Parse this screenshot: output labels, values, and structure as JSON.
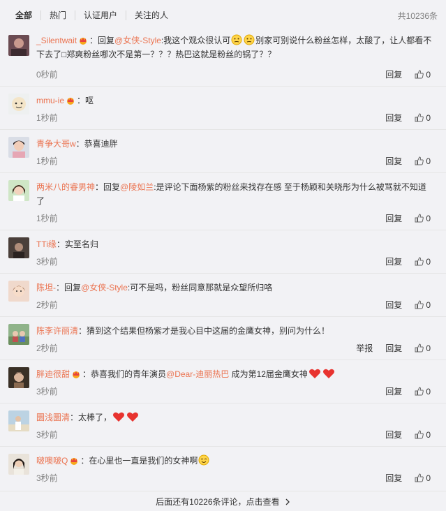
{
  "tabs": [
    {
      "label": "全部"
    },
    {
      "label": "热门"
    },
    {
      "label": "认证用户"
    },
    {
      "label": "关注的人"
    }
  ],
  "total_count": "共10236条",
  "reply_label": "回复",
  "report_label": "举报",
  "comments": [
    {
      "user": "_Silentwait",
      "time": "0秒前",
      "likes": "0",
      "pre": "：回复",
      "at": "@女侠-Style",
      "text1": ":我这个观众很认可",
      "text2": "别家可别说什么粉丝怎样，太酸了，让人都看不下去了□郑爽粉丝哪次不是第一？？？热巴这就是粉丝的锅了？？"
    },
    {
      "user": "mmu-ie",
      "time": "1秒前",
      "likes": "0",
      "text": "：呕"
    },
    {
      "user": "青争大哥w",
      "time": "1秒前",
      "likes": "0",
      "text": "：恭喜迪胖"
    },
    {
      "user": "两米八的睿男神",
      "time": "1秒前",
      "likes": "0",
      "pre": "：回复",
      "at": "@陵如兰",
      "text1": ":是评论下面杨紫的粉丝来找存在感 至于杨颖和关晓彤为什么被骂就不知道了"
    },
    {
      "user": "TTi缘",
      "time": "3秒前",
      "likes": "0",
      "text": "：实至名归"
    },
    {
      "user": "陈坦-",
      "time": "2秒前",
      "likes": "0",
      "pre": "：回复",
      "at": "@女侠-Style",
      "text1": ":可不是吗，粉丝同意那就是众望所归咯"
    },
    {
      "user": "陈李许丽清",
      "time": "2秒前",
      "likes": "0",
      "text": "：猜到这个结果但杨紫才是我心目中这届的金鹰女神，别问为什么！"
    },
    {
      "user": "胖迪很甜",
      "time": "3秒前",
      "likes": "0",
      "pre": "：恭喜我们的青年演员",
      "at": "@Dear-迪丽热巴",
      "text1": " 成为第12届金鹰女神"
    },
    {
      "user": "圜浅圜清",
      "time": "3秒前",
      "likes": "0",
      "text": "：太棒了，"
    },
    {
      "user": "啵噢啵Q",
      "time": "3秒前",
      "likes": "0",
      "text": "：在心里也一直是我们的女神啊"
    }
  ],
  "more_text": "后面还有10226条评论，点击查看",
  "colors": {
    "accent": "#eb7350",
    "background": "#f2f2f5",
    "divider": "#e6e6e6",
    "muted": "#808080"
  }
}
